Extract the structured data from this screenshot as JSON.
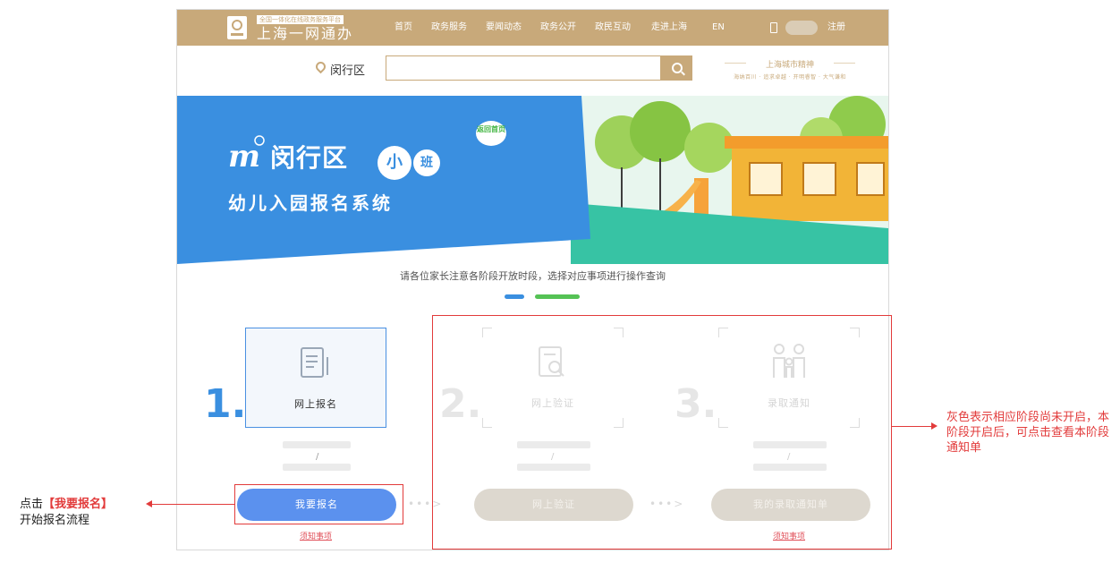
{
  "header": {
    "logo_tag": "全国一体化在线政务服务平台",
    "logo_title": "上海一网通办",
    "nav": [
      "首页",
      "政务服务",
      "要闻动态",
      "政务公开",
      "政民互动",
      "走进上海",
      "EN"
    ],
    "register": "注册"
  },
  "search": {
    "district": "闵行区",
    "placeholder": "",
    "brand_title": "上海城市精神",
    "brand_subtitle": "海纳百川 · 追求卓越 · 开明睿智 · 大气谦和"
  },
  "banner": {
    "title": "闵行区",
    "badge_small": "小",
    "badge_class": "班",
    "speech_badge": "返回首页",
    "subtitle": "幼儿入园报名系统"
  },
  "tip": "请各位家长注意各阶段开放时段，选择对应事项进行操作查询",
  "steps": [
    {
      "num": "1.",
      "label": "网上报名",
      "button": "我要报名",
      "link": "须知事项",
      "color": "#3a8fe0"
    },
    {
      "num": "2.",
      "label": "网上验证",
      "button": "网上验证",
      "link": "",
      "color": "#e9e9e9"
    },
    {
      "num": "3.",
      "label": "录取通知",
      "button": "我的录取通知单",
      "link": "须知事项",
      "color": "#e9e9e9"
    }
  ],
  "slash": "/",
  "annotations": {
    "left_prefix": "点击",
    "left_highlight": "【我要报名】",
    "left_line2": "开始报名流程",
    "right": "灰色表示相应阶段尚未开启，本阶段开启后，可点击查看本阶段通知单"
  },
  "colors": {
    "gold": "#c8a97a",
    "blue": "#3a8fe0",
    "green": "#55c255",
    "red": "#e23b3b"
  }
}
